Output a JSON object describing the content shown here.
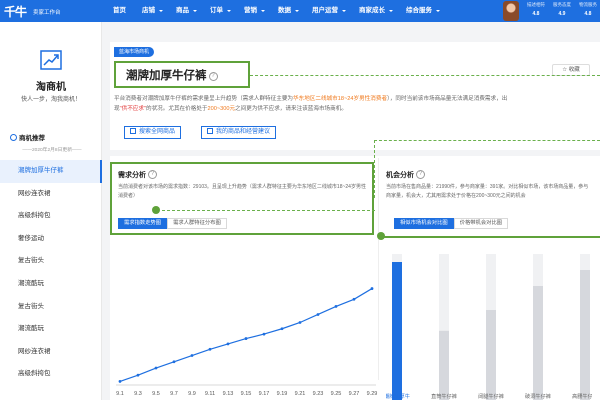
{
  "header": {
    "logo": "千牛",
    "logo_sub": "卖家工作台",
    "nav": [
      {
        "label": "首页",
        "dropdown": false
      },
      {
        "label": "店铺",
        "dropdown": true
      },
      {
        "label": "商品",
        "dropdown": true
      },
      {
        "label": "订单",
        "dropdown": true
      },
      {
        "label": "营销",
        "dropdown": true
      },
      {
        "label": "数据",
        "dropdown": true
      },
      {
        "label": "用户运营",
        "dropdown": true
      },
      {
        "label": "商家成长",
        "dropdown": true
      },
      {
        "label": "综合服务",
        "dropdown": true
      }
    ],
    "stats": [
      {
        "label": "描述相符",
        "value": "4.8"
      },
      {
        "label": "服务态度",
        "value": "4.9"
      },
      {
        "label": "物流服务",
        "value": "4.8"
      }
    ]
  },
  "sidebar": {
    "title": "淘商机",
    "subtitle": "快人一步，淘我商机！",
    "section": "商机推荐",
    "date": "——2020年2月8日更新——",
    "items": [
      {
        "label": "潮牌加厚牛仔裤",
        "active": true
      },
      {
        "label": "网纱连衣裙",
        "active": false
      },
      {
        "label": "高级斜挎包",
        "active": false
      },
      {
        "label": "奢侈运动",
        "active": false
      },
      {
        "label": "复古街头",
        "active": false
      },
      {
        "label": "潮流酷玩",
        "active": false
      },
      {
        "label": "复古街头",
        "active": false
      },
      {
        "label": "潮流酷玩",
        "active": false
      },
      {
        "label": "网纱连衣裙",
        "active": false
      },
      {
        "label": "高级斜挎包",
        "active": false
      }
    ]
  },
  "main": {
    "ribbon": "蓝海市场商机",
    "title": "潮牌加厚牛仔裤",
    "favorite": "收藏",
    "desc": {
      "p1": "平台消费者对潮牌加厚牛仔裤的需求量呈上升趋势（需求人群特征主要为",
      "hl1": "华东地区二线城市18~24岁男性消费者",
      "p2": "），同时当前该市场商品量无法满足消费需求，出",
      "p3": "现",
      "red1": "\"供不应求\"",
      "p4": "的状况。尤其在价格处于",
      "hl2": "200~300元",
      "p5": "之间更为供不应求，请来注该蓝海市场商机。"
    },
    "buttons": {
      "search": "搜索全网商品",
      "mine": "我的商品和经营建议"
    }
  },
  "demand": {
    "title": "需求分析",
    "desc": "当前消费者对该市场的需求指数：29103。且呈现上升趋势（需求人群特征主要为华东地区二线城市18~24岁男性消费者）",
    "tabs": [
      {
        "label": "需求指数走势图",
        "active": true
      },
      {
        "label": "需求人群特征分布图",
        "active": false
      }
    ]
  },
  "opportunity": {
    "title": "机会分析",
    "desc": "当前市场在售商品量：21990件，参与商家量：391家。对比相似市场，该市场商品量，参与商家量，机会大，尤其用需求处于价格在200~300元之间的机会",
    "tabs": [
      {
        "label": "相似市场机会对比图",
        "active": true
      },
      {
        "label": "价格带机会对比图",
        "active": false
      }
    ]
  },
  "chart_data": [
    {
      "type": "line",
      "categories": [
        "9.1",
        "9.3",
        "9.5",
        "9.7",
        "9.9",
        "9.11",
        "9.13",
        "9.15",
        "9.17",
        "9.19",
        "9.21",
        "9.23",
        "9.25",
        "9.27",
        "9.29"
      ],
      "series": [
        {
          "values": [
            4,
            11,
            19,
            26,
            33,
            40,
            46,
            52,
            57,
            63,
            70,
            79,
            88,
            96,
            108
          ]
        }
      ],
      "ylim": [
        0,
        140
      ],
      "color": "#1e6fe0"
    },
    {
      "type": "bar",
      "categories": [
        "潮牌加厚牛",
        "直筒牛仔裤",
        "阔腿牛仔裤",
        "破洞牛仔裤",
        "高腰牛仔裤"
      ],
      "series": [
        {
          "values": [
            95,
            52,
            65,
            80,
            90
          ],
          "colors": [
            "#1e6fe0",
            "#d6d8dd",
            "#d6d8dd",
            "#d6d8dd",
            "#d6d8dd"
          ]
        }
      ],
      "ylim": [
        0,
        100
      ]
    }
  ]
}
